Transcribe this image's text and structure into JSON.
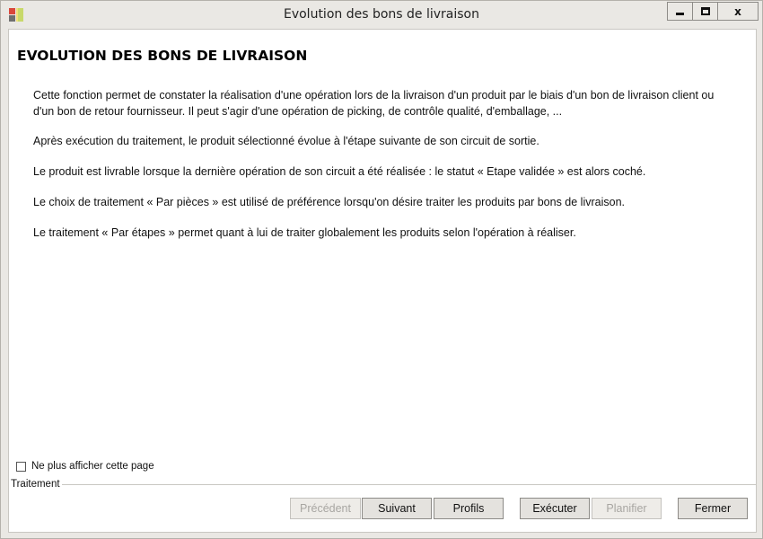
{
  "window": {
    "title": "Evolution des bons de livraison",
    "minimize_label": "",
    "maximize_label": "",
    "close_label": "x"
  },
  "content": {
    "heading": "EVOLUTION DES BONS DE LIVRAISON",
    "paragraphs": [
      "Cette fonction permet de constater la réalisation d'une opération lors de la livraison d'un produit par le biais d'un bon de livraison client ou d'un bon de retour fournisseur. Il peut s'agir d'une opération de picking, de contrôle qualité, d'emballage, ...",
      "Après exécution du traitement, le produit sélectionné évolue à l'étape suivante de son circuit de sortie.",
      "Le produit est livrable lorsque la dernière opération de son circuit a été réalisée : le statut « Etape validée » est alors coché.",
      "Le choix de traitement « Par pièces » est utilisé de préférence lorsqu'on désire traiter les produits par bons de livraison.",
      "Le traitement « Par étapes » permet quant à lui de traiter globalement les produits selon l'opération à réaliser."
    ]
  },
  "footer": {
    "checkbox_label": "Ne plus afficher cette page",
    "checkbox_checked": false,
    "group_label": "Traitement",
    "buttons": {
      "precedent": "Précédent",
      "suivant": "Suivant",
      "profils": "Profils",
      "executer": "Exécuter",
      "planifier": "Planifier",
      "fermer": "Fermer"
    }
  }
}
